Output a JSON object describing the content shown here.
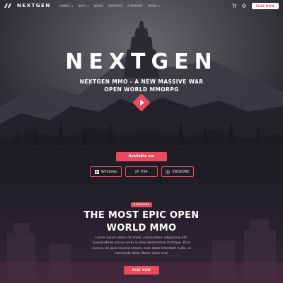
{
  "nav": {
    "brand": "NEXTGEN",
    "items": [
      "GAMES ▾",
      "DKTS ▾",
      "NEWS",
      "ESPORTS",
      "COMPANY",
      "MORE ▾"
    ],
    "play_now": "PLAY NOW"
  },
  "hero": {
    "title": "NEXTGEN",
    "subtitle_line1": "NEXTGEN MMO - A NEW MASSIVE WAR",
    "subtitle_line2": "OPEN WORLD MMORPG"
  },
  "available": {
    "label": "Available on:",
    "platforms": [
      "Windows",
      "PS4",
      "XBOXONE"
    ]
  },
  "section": {
    "tag": "DISCOVER",
    "title_line1": "THE MOST EPIC OPEN",
    "title_line2": "WORLD MMO",
    "text_line1": "Lorem ipsum dolor sit amet, consectetur adipiscing elit.",
    "text_line2": "Suspendisse varius enim in eros elementum tristique. Duis",
    "text_line3": "cursus, mi quis viverra ornare, eros dolor interdum nulla, ut",
    "text_line4": "commodo diam libero vitae erat.",
    "button": "PLAY NOW"
  },
  "colors": {
    "accent": "#ec4a5c",
    "background": "#1f1d24"
  },
  "icons": [
    "logo-icon",
    "cart-icon",
    "globe-icon",
    "play-icon",
    "windows-icon",
    "ps4-icon",
    "xbox-icon"
  ]
}
